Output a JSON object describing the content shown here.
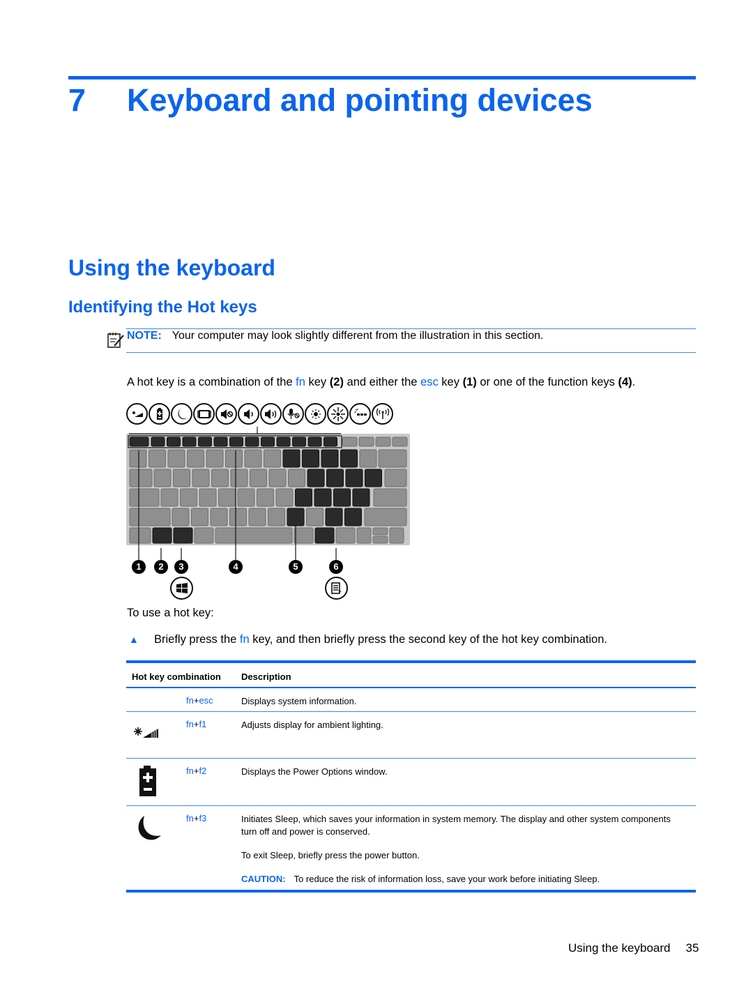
{
  "chapter": {
    "number": "7",
    "title": "Keyboard and pointing devices"
  },
  "section": {
    "title": "Using the keyboard",
    "subsection": "Identifying the Hot keys"
  },
  "note": {
    "icon": "note-pencil-icon",
    "label": "NOTE:",
    "text": "Your computer may look slightly different from the illustration in this section."
  },
  "intro": {
    "p1": "A hot key is a combination of the ",
    "fn": "fn",
    "p2": " key ",
    "ref2": "(2)",
    "p3": " and either the ",
    "esc": "esc",
    "p4": " key ",
    "ref1": "(1)",
    "p5": " or one of the function keys ",
    "ref4": "(4)",
    "p6": "."
  },
  "illustration": {
    "function_icons": [
      "ambient-light-icon",
      "battery-icon",
      "sleep-moon-icon",
      "display-switch-icon",
      "mute-icon",
      "volume-down-icon",
      "volume-up-icon",
      "mic-mute-icon",
      "brightness-down-icon",
      "brightness-up-icon",
      "keyboard-backlight-icon",
      "wireless-icon"
    ],
    "callouts": [
      "1",
      "2",
      "3",
      "4",
      "5",
      "6"
    ],
    "extra_icons": [
      "windows-logo-icon",
      "application-menu-icon"
    ]
  },
  "usage": {
    "lead": "To use a hot key:",
    "step_a": "Briefly press the ",
    "step_fn": "fn",
    "step_b": " key, and then briefly press the second key of the hot key combination."
  },
  "table": {
    "headers": [
      "Hot key combination",
      "Description"
    ],
    "rows": [
      {
        "icon": "",
        "key1": "fn",
        "plus": "+",
        "key2": "esc",
        "description": "Displays system information."
      },
      {
        "icon": "ambient-light-icon",
        "key1": "fn",
        "plus": "+",
        "key2": "f1",
        "description": "Adjusts display for ambient lighting."
      },
      {
        "icon": "battery-icon",
        "key1": "fn",
        "plus": "+",
        "key2": "f2",
        "description": "Displays the Power Options window."
      },
      {
        "icon": "sleep-moon-icon",
        "key1": "fn",
        "plus": "+",
        "key2": "f3",
        "description": "Initiates Sleep, which saves your information in system memory. The display and other system components turn off and power is conserved.",
        "extra": "To exit Sleep, briefly press the power button.",
        "caution_label": "CAUTION:",
        "caution_text": "To reduce the risk of information loss, save your work before initiating Sleep."
      }
    ]
  },
  "footer": {
    "section": "Using the keyboard",
    "page": "35"
  },
  "colors": {
    "accent": "#0a64f0",
    "link": "#0066ff"
  }
}
